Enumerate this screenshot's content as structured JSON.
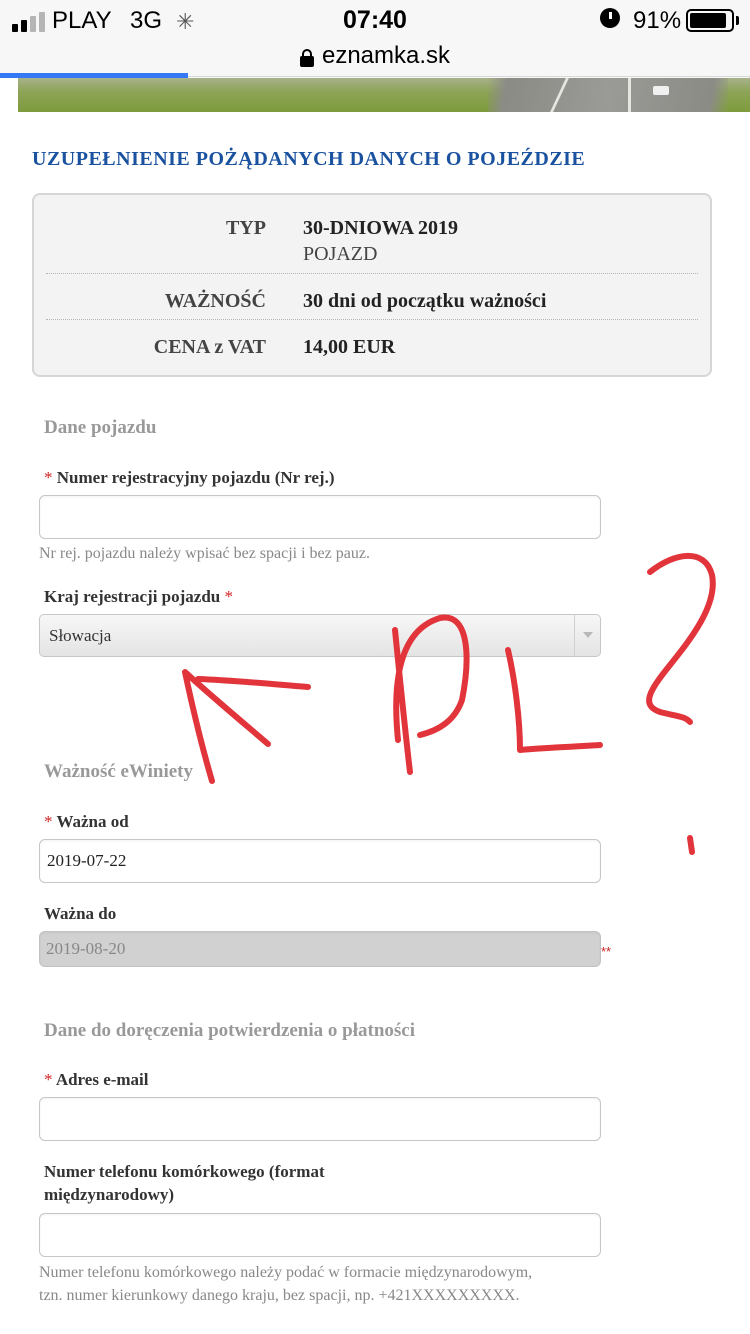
{
  "status_bar": {
    "carrier": "PLAY",
    "network": "3G",
    "time": "07:40",
    "battery_percent": "91%",
    "battery_level": 0.91,
    "alarm_icon": "alarm-clock-icon"
  },
  "browser": {
    "url": "eznamka.sk",
    "lock_icon": "lock-icon",
    "load_progress": 0.25
  },
  "page": {
    "section_title": "UZUPEŁNIENIE POŻĄDANYCH DANYCH O POJEŹDZIE",
    "summary": {
      "type_label": "TYP",
      "type_value": "30-DNIOWA 2019",
      "type_value_sub": "POJAZD",
      "validity_label": "WAŻNOŚĆ",
      "validity_value": "30 dni od początku ważności",
      "price_label": "CENA z VAT",
      "price_value": "14,00 EUR"
    },
    "vehicle": {
      "title": "Dane pojazdu",
      "plate_label": "Numer rejestracyjny pojazdu (Nr rej.)",
      "plate_value": "",
      "plate_help": "Nr rej. pojazdu należy wpisać bez spacji i bez pauz.",
      "country_label": "Kraj rejestracji pojazdu",
      "country_value": "Słowacja"
    },
    "validity": {
      "title": "Ważność eWiniety",
      "from_label": "Ważna od",
      "from_value": "2019-07-22",
      "to_label": "Ważna do",
      "to_value": "2019-08-20",
      "to_marker": "**"
    },
    "delivery": {
      "title": "Dane do doręczenia potwierdzenia o płatności",
      "email_label": "Adres e-mail",
      "email_value": "",
      "phone_label_line1": "Numer telefonu komórkowego (format",
      "phone_label_line2": "międzynarodowy)",
      "phone_value": "",
      "phone_help_line1": "Numer telefonu komórkowego należy podać w formacie międzynarodowym,",
      "phone_help_line2": "tzn. numer kierunkowy danego kraju, bez spacji, np. +421XXXXXXXXX."
    },
    "required_marker": "*",
    "annotation_color": "#e2353b"
  }
}
